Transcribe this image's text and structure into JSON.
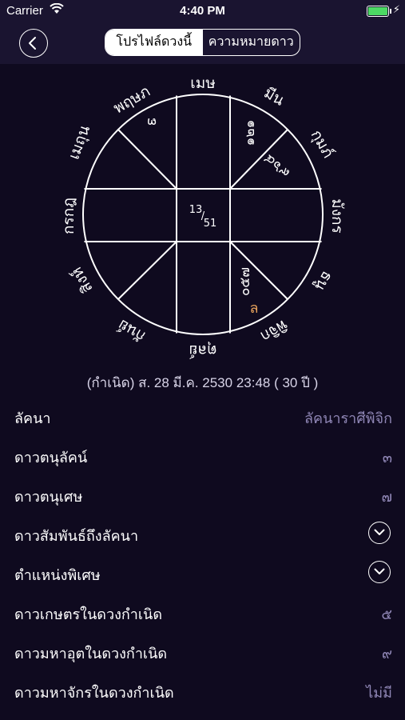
{
  "status_bar": {
    "carrier": "Carrier",
    "time": "4:40 PM"
  },
  "nav": {
    "tabs": [
      {
        "label": "โปรไฟล์ดวงนี้",
        "active": true
      },
      {
        "label": "ความหมายดาว",
        "active": false
      }
    ]
  },
  "chart": {
    "signs": {
      "mesh": "เมษ",
      "prueksa": "พฤษภ",
      "mithun": "เมถุน",
      "kaikod": "กรกฎ",
      "sing": "สิงห์",
      "kanya": "กันย์",
      "tul": "ตุลย์",
      "pichik": "พิจิก",
      "tanu": "ธนู",
      "mangkorn": "มังกร",
      "kumbh": "กุมภ์",
      "meen": "มีน"
    },
    "houses": {
      "prueksa": "๓",
      "meen": "๑๒๑",
      "kumbh": "๙๖๔",
      "pichik": "๐๕๗",
      "pichik_lagna": "ล"
    },
    "center": {
      "top": "13",
      "bottom": "51"
    },
    "accent_color": "#e8a35c"
  },
  "birth_info": "(กำเนิด) ส. 28 มี.ค. 2530 23:48 ( 30 ปี )",
  "rows": [
    {
      "label": "ลัคนา",
      "value": "ลัคนาราศีพิจิก"
    },
    {
      "label": "ดาวตนุลัคน์",
      "value": "๓"
    },
    {
      "label": "ดาวตนุเศษ",
      "value": "๗"
    },
    {
      "label": "ดาวสัมพันธ์ถึงลัคนา",
      "value": ""
    },
    {
      "label": "ตำแหน่งพิเศษ",
      "value": ""
    },
    {
      "label": "ดาวเกษตรในดวงกำเนิด",
      "value": "๕"
    },
    {
      "label": "ดาวมหาอุตในดวงกำเนิด",
      "value": "๙"
    },
    {
      "label": "ดาวมหาจักรในดวงกำเนิด",
      "value": "ไม่มี"
    }
  ]
}
